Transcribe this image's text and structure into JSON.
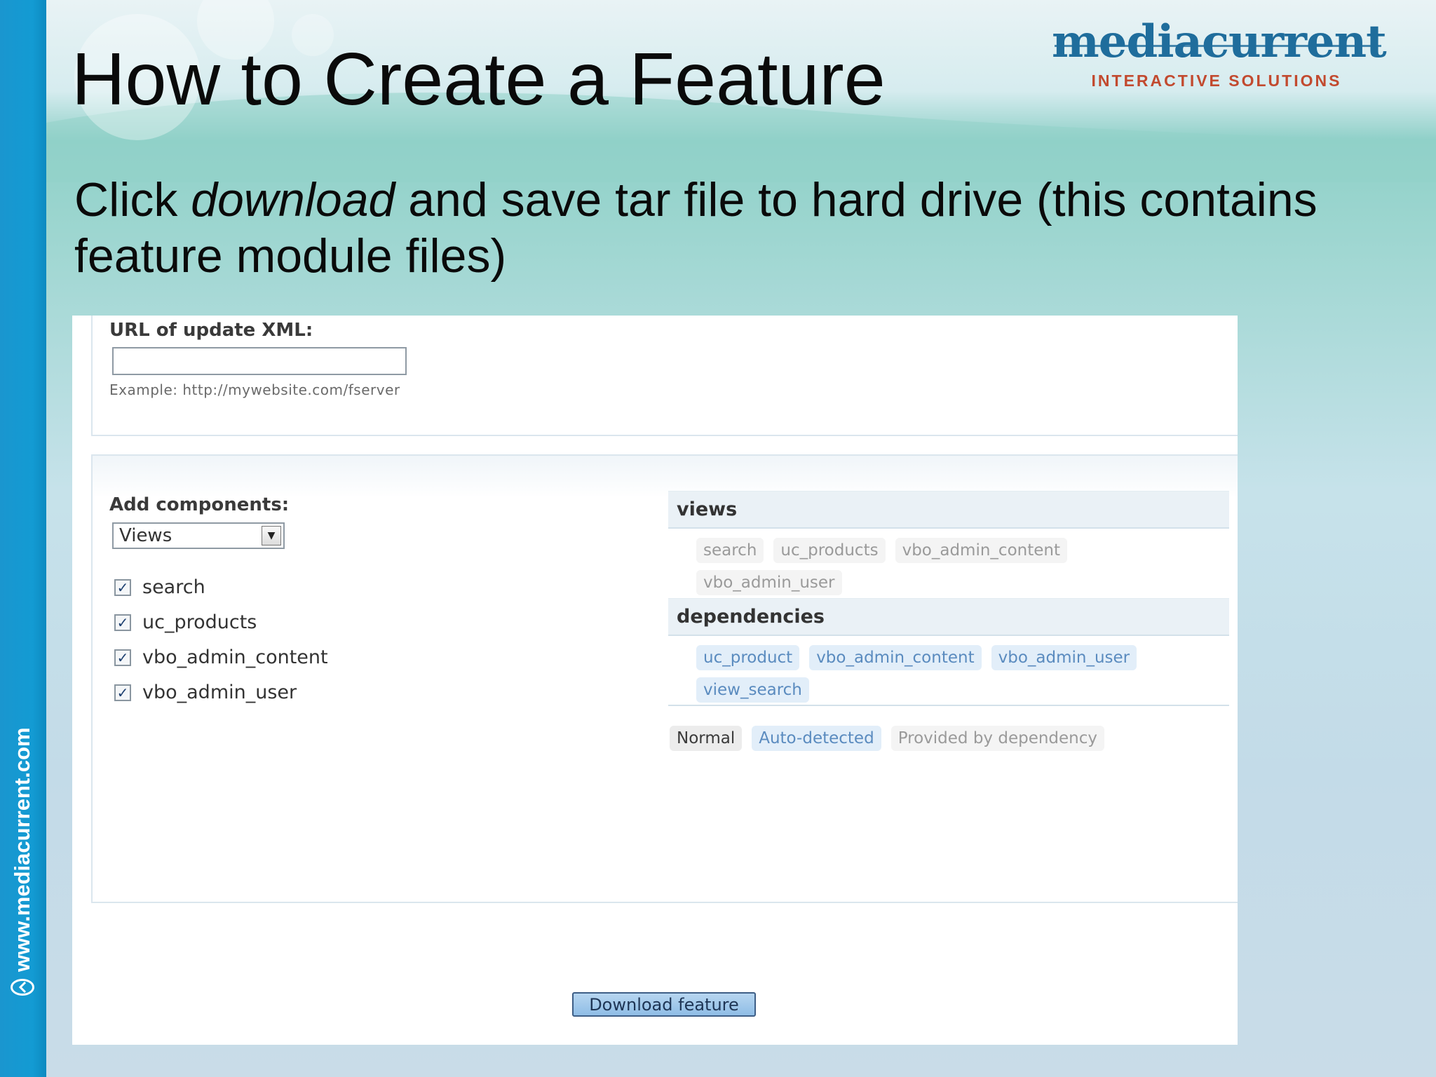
{
  "slide": {
    "title": "How to Create a Feature",
    "subtitle_parts": [
      "Click ",
      "download",
      " and save tar file to hard drive (this contains feature module files)"
    ],
    "site_url": "www.mediacurrent.com",
    "logo_wordmark": "mediacurrent",
    "logo_tagline": "INTERACTIVE SOLUTIONS",
    "sidebar_color": "#139bd3"
  },
  "form": {
    "url_label": "URL of update XML:",
    "url_value": "",
    "url_description": "Example: http://mywebsite.com/fserver",
    "components_label": "Add components:",
    "components_select": "Views",
    "checkboxes": [
      {
        "label": "search",
        "checked": true
      },
      {
        "label": "uc_products",
        "checked": true
      },
      {
        "label": "vbo_admin_content",
        "checked": true
      },
      {
        "label": "vbo_admin_user",
        "checked": true
      }
    ],
    "views_heading": "views",
    "views_items": [
      "search",
      "uc_products",
      "vbo_admin_content",
      "vbo_admin_user"
    ],
    "dependencies_heading": "dependencies",
    "dependencies_items": [
      "uc_product",
      "vbo_admin_content",
      "vbo_admin_user",
      "view_search"
    ],
    "legend": {
      "normal": "Normal",
      "auto": "Auto-detected",
      "provided": "Provided by dependency"
    },
    "download_button": "Download feature"
  }
}
